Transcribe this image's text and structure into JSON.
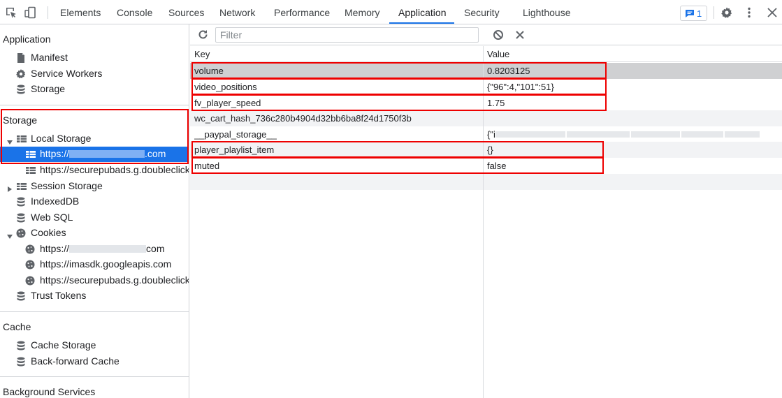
{
  "tabs": [
    "Elements",
    "Console",
    "Sources",
    "Network",
    "Performance",
    "Memory",
    "Application",
    "Security",
    "Lighthouse"
  ],
  "active_tab": "Application",
  "issues_count": "1",
  "icons": {
    "inspect": "inspect-element-icon",
    "device": "device-toolbar-icon",
    "issues": "issues-message-icon",
    "settings": "gear-icon",
    "more": "more-vertical-icon",
    "close": "close-icon",
    "refresh": "refresh-icon",
    "clear": "clear-all-icon",
    "delete": "delete-selected-icon"
  },
  "colors": {
    "accent": "#1a73e8",
    "highlight": "#e00000"
  },
  "sidebar": {
    "application_header": "Application",
    "application_items": [
      "Manifest",
      "Service Workers",
      "Storage"
    ],
    "storage_header": "Storage",
    "local_storage": "Local Storage",
    "local_storage_children": {
      "item1_prefix": "https://",
      "item1_suffix": ".com",
      "item2": "https://securepubads.g.doubleclick.net"
    },
    "session_storage": "Session Storage",
    "indexeddb": "IndexedDB",
    "websql": "Web SQL",
    "cookies": "Cookies",
    "cookie_children": {
      "item1_prefix": "https://",
      "item1_suffix": "com",
      "item2": "https://imasdk.googleapis.com",
      "item3": "https://securepubads.g.doubleclick.net"
    },
    "trust_tokens": "Trust Tokens",
    "cache_header": "Cache",
    "cache_items": [
      "Cache Storage",
      "Back-forward Cache"
    ],
    "background_header": "Background Services"
  },
  "main": {
    "filter_placeholder": "Filter",
    "columns": {
      "key": "Key",
      "value": "Value"
    },
    "rows": [
      {
        "key": "volume",
        "value": "0.8203125"
      },
      {
        "key": "video_positions",
        "value": "{\"96\":4,\"101\":51}"
      },
      {
        "key": "fv_player_speed",
        "value": "1.75"
      },
      {
        "key": "wc_cart_hash_736c280b4904d32bb6ba8f24d1750f3b",
        "value": ""
      },
      {
        "key": "__paypal_storage__",
        "value": "{\"i"
      },
      {
        "key": "player_playlist_item",
        "value": "{}"
      },
      {
        "key": "muted",
        "value": "false"
      }
    ]
  }
}
